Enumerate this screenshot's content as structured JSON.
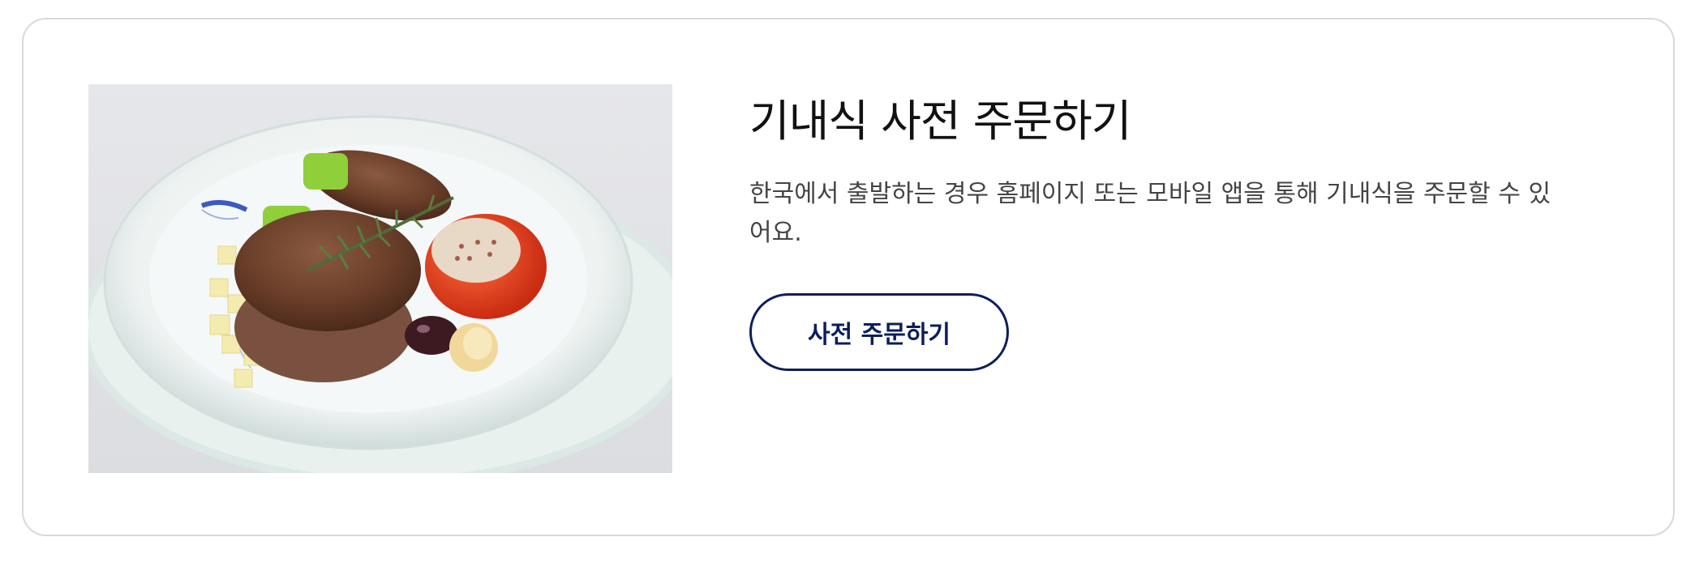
{
  "card": {
    "title": "기내식 사전 주문하기",
    "description": "한국에서 출발하는 경우 홈페이지 또는 모바일 앱을 통해 기내식을 주문할 수 있어요.",
    "button_label": "사전 주문하기",
    "accent_color": "#0c1e5b",
    "image_icon": "steak-meal-photo"
  }
}
